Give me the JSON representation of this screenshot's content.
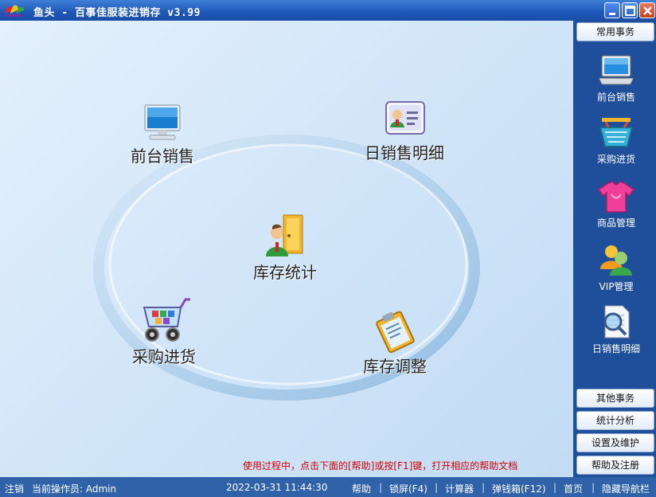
{
  "window": {
    "title": "鱼头 - 百事佳服装进销存 v3.99"
  },
  "hub": {
    "items": [
      {
        "id": "front-sales",
        "label": "前台销售",
        "icon": "monitor-icon"
      },
      {
        "id": "daily-sales-detail",
        "label": "日销售明细",
        "icon": "id-card-icon"
      },
      {
        "id": "inventory-stats",
        "label": "库存统计",
        "icon": "person-door-icon"
      },
      {
        "id": "purchase-stock",
        "label": "采购进货",
        "icon": "shopping-cart-icon"
      },
      {
        "id": "inventory-adjust",
        "label": "库存调整",
        "icon": "clipboard-icon"
      }
    ],
    "help_hint": "使用过程中，点击下面的[帮助]或按[F1]键，打开相应的帮助文档"
  },
  "sidebar": {
    "top_tab": "常用事务",
    "items": [
      {
        "label": "前台销售",
        "icon": "laptop-icon"
      },
      {
        "label": "采购进货",
        "icon": "basket-icon"
      },
      {
        "label": "商品管理",
        "icon": "tshirt-icon"
      },
      {
        "label": "VIP管理",
        "icon": "users-icon"
      },
      {
        "label": "日销售明细",
        "icon": "document-search-icon"
      }
    ],
    "bottom_tabs": [
      "其他事务",
      "统计分析",
      "设置及维护",
      "帮助及注册"
    ]
  },
  "status": {
    "logout": "注销",
    "operator": "当前操作员: Admin",
    "datetime": "2022-03-31 11:44:30",
    "links": [
      "帮助",
      "锁屏(F4)",
      "计算器",
      "弹钱箱(F12)",
      "首页",
      "隐藏导航栏"
    ]
  },
  "colors": {
    "titlebar": "#1e57b8",
    "sidebar": "#1f4f9a",
    "statusbar": "#2f62a8",
    "hint": "#d40000"
  }
}
